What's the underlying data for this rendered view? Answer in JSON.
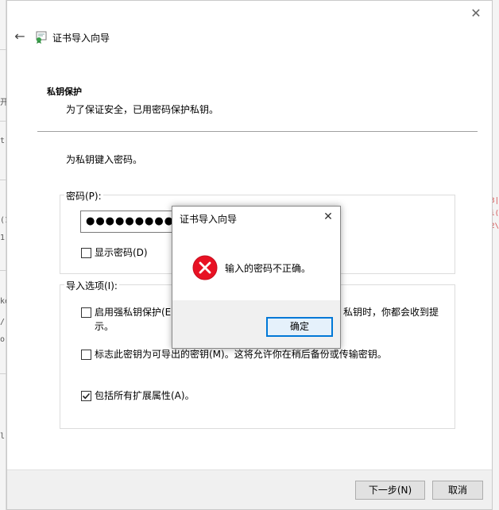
{
  "background": {
    "left_fragments": [
      "开",
      "t.",
      "(1",
      "1",
      "ke",
      "/",
      "o",
      "l."
    ],
    "right_fragments": [
      "3|",
      "i(",
      "2\\"
    ]
  },
  "wizard": {
    "title": "证书导入向导",
    "section_title": "私钥保护",
    "section_desc": "为了保证安全，已用密码保护私钥。",
    "prompt": "为私钥键入密码。",
    "password_group": {
      "legend": "密码(P):",
      "password_mask": "●●●●●●●●●●●",
      "show_password_label": "显示密码(D)",
      "show_password_checked": false
    },
    "options_group": {
      "legend": "导入选项(I):",
      "strong_protection": {
        "label_line1_left": "启用强私钥保护(E)",
        "label_line1_right": "私钥时，你都会收到提",
        "label_line2": "示。",
        "checked": false
      },
      "exportable": {
        "label": "标志此密钥为可导出的密钥(M)。这将允许你在稍后备份或传输密钥。",
        "checked": false
      },
      "include_ext": {
        "label": "包括所有扩展属性(A)。",
        "checked": true
      }
    },
    "buttons": {
      "next": "下一步(N)",
      "cancel": "取消"
    }
  },
  "modal": {
    "title": "证书导入向导",
    "message": "输入的密码不正确。",
    "ok": "确定",
    "icon": "error-icon",
    "icon_color": "#e81123"
  }
}
